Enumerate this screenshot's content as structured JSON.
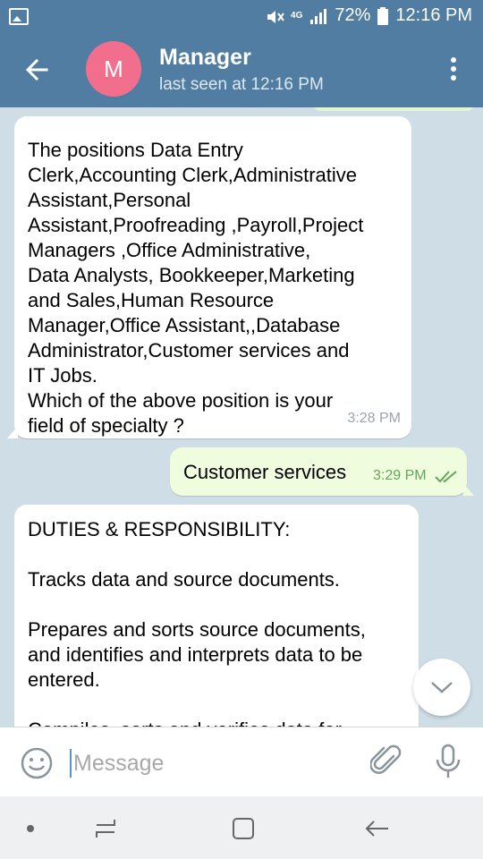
{
  "status_bar": {
    "battery": "72%",
    "time": "12:16 PM",
    "network": "4G"
  },
  "header": {
    "avatar_letter": "M",
    "title": "Manager",
    "subtitle": "last seen at 12:16 PM",
    "avatar_color": "#f16f8d",
    "bar_color": "#527da3"
  },
  "messages": [
    {
      "direction": "incoming",
      "text": "The positions Data Entry\nClerk,Accounting Clerk,Administrative\nAssistant,Personal\nAssistant,Proofreading ,Payroll,Project\nManagers ,Office Administrative,\nData Analysts, Bookkeeper,Marketing\nand Sales,Human Resource\nManager,Office Assistant,,Database\nAdministrator,Customer services and\nIT Jobs.\nWhich of the above position is your\nfield of specialty ?",
      "time": "3:28 PM"
    },
    {
      "direction": "outgoing",
      "text": "Customer services",
      "time": "3:29 PM",
      "status_icon": "double-check-icon"
    },
    {
      "direction": "incoming",
      "text": "DUTIES & RESPONSIBILITY:\n\nTracks data and source documents.\n\nPrepares and sorts source documents,\nand identifies and interprets data to be\nentered.\n\nCompiles, sorts and verifies data for"
    }
  ],
  "composer": {
    "placeholder": "Message"
  },
  "icons": {
    "back": "arrow-left-icon",
    "menu": "more-vertical-icon",
    "scroll": "chevron-down-icon",
    "emoji": "smile-icon",
    "attach": "paperclip-icon",
    "mic": "microphone-icon"
  }
}
